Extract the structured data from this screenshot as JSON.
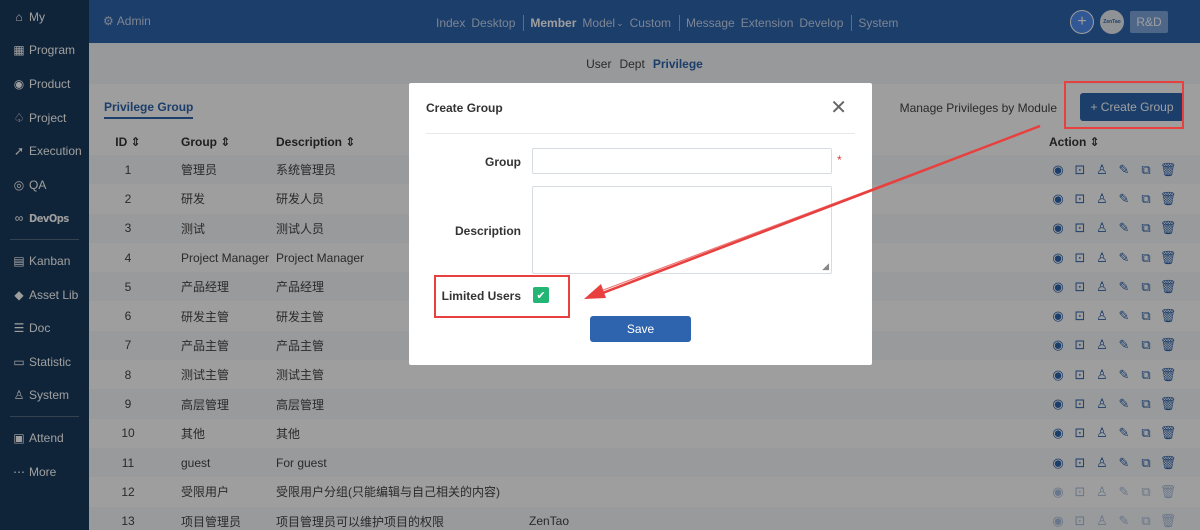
{
  "sidebar": {
    "items": [
      {
        "label": "My",
        "icon": "home-icon",
        "glyph": "⌂"
      },
      {
        "label": "Program",
        "icon": "grid-icon",
        "glyph": "▦"
      },
      {
        "label": "Product",
        "icon": "bulb-icon",
        "glyph": "◉"
      },
      {
        "label": "Project",
        "icon": "project-icon",
        "glyph": "♤"
      },
      {
        "label": "Execution",
        "icon": "run-icon",
        "glyph": "➚"
      },
      {
        "label": "QA",
        "icon": "qa-icon",
        "glyph": "◎"
      },
      {
        "label": "DevOps",
        "icon": "infinity-icon",
        "glyph": "∞"
      },
      {
        "label": "Kanban",
        "icon": "kanban-icon",
        "glyph": "▤"
      },
      {
        "label": "Asset Lib",
        "icon": "diamond-icon",
        "glyph": "◆"
      },
      {
        "label": "Doc",
        "icon": "doc-icon",
        "glyph": "☰"
      },
      {
        "label": "Statistic",
        "icon": "chart-icon",
        "glyph": "▭"
      },
      {
        "label": "System",
        "icon": "users-icon",
        "glyph": "♙"
      },
      {
        "label": "Attend",
        "icon": "calendar-icon",
        "glyph": "▣"
      },
      {
        "label": "More",
        "icon": "more-icon",
        "glyph": "⋯"
      }
    ]
  },
  "topbar": {
    "admin": "Admin",
    "nav": [
      "Index",
      "Desktop",
      "Member",
      "Model",
      "Custom",
      "Message",
      "Extension",
      "Develop",
      "System"
    ],
    "active": "Member",
    "logo_text": "ZenTao",
    "rd_label": "R&D"
  },
  "subnav": {
    "items": [
      "User",
      "Dept",
      "Privilege"
    ],
    "active": "Privilege"
  },
  "toolbar": {
    "tab": "Privilege Group",
    "manage_link": "Manage Privileges by Module",
    "create_button": "+ Create Group"
  },
  "table": {
    "headers": {
      "id": "ID",
      "group": "Group",
      "description": "Description",
      "action": "Action"
    },
    "rows": [
      {
        "id": "1",
        "group": "管理员",
        "desc": "系统管理员",
        "extra": ""
      },
      {
        "id": "2",
        "group": "研发",
        "desc": "研发人员",
        "extra": ""
      },
      {
        "id": "3",
        "group": "测试",
        "desc": "测试人员",
        "extra": ""
      },
      {
        "id": "4",
        "group": "Project Manager",
        "desc": "Project Manager",
        "extra": ""
      },
      {
        "id": "5",
        "group": "产品经理",
        "desc": "产品经理",
        "extra": ""
      },
      {
        "id": "6",
        "group": "研发主管",
        "desc": "研发主管",
        "extra": ""
      },
      {
        "id": "7",
        "group": "产品主管",
        "desc": "产品主管",
        "extra": ""
      },
      {
        "id": "8",
        "group": "测试主管",
        "desc": "测试主管",
        "extra": ""
      },
      {
        "id": "9",
        "group": "高层管理",
        "desc": "高层管理",
        "extra": ""
      },
      {
        "id": "10",
        "group": "其他",
        "desc": "其他",
        "extra": ""
      },
      {
        "id": "11",
        "group": "guest",
        "desc": "For guest",
        "extra": ""
      },
      {
        "id": "12",
        "group": "受限用户",
        "desc": "受限用户分组(只能编辑与自己相关的内容)",
        "extra": ""
      },
      {
        "id": "13",
        "group": "项目管理员",
        "desc": "项目管理员可以维护项目的权限",
        "extra": "ZenTao"
      }
    ]
  },
  "modal": {
    "title": "Create Group",
    "group_label": "Group",
    "group_value": "",
    "description_label": "Description",
    "description_value": "",
    "limited_label": "Limited Users",
    "limited_checked": true,
    "save_label": "Save"
  },
  "colors": {
    "sidebar": "#1b3a5c",
    "topbar": "#2e64ad",
    "primary": "#2e64ad",
    "check": "#22b573",
    "annotation": "#e8403f"
  }
}
